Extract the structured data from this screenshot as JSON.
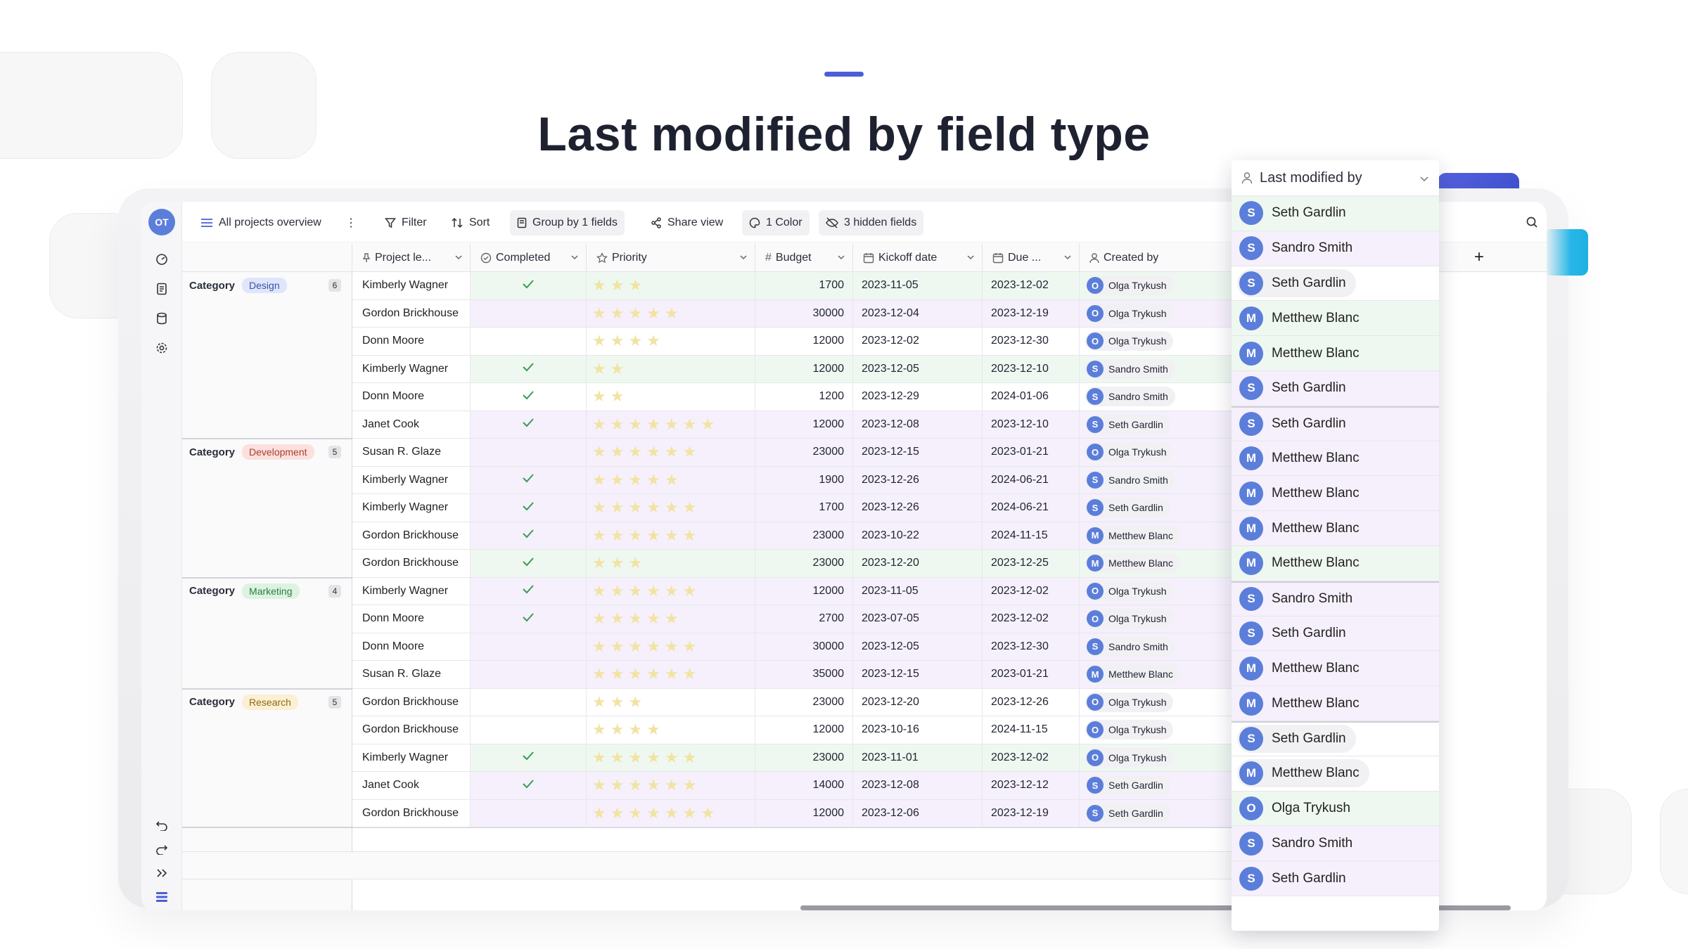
{
  "hero": {
    "title": "Last modified by field type"
  },
  "colors": {
    "accent": "#4b5fd6",
    "avatar": "#5c7edb",
    "row_green": "#eef8f0",
    "row_purple": "#f5f0fb"
  },
  "user": {
    "initials": "OT"
  },
  "toolbar": {
    "view_name": "All projects overview",
    "filter": "Filter",
    "sort": "Sort",
    "group": "Group by 1 fields",
    "share": "Share view",
    "color": "1 Color",
    "hidden": "3 hidden fields"
  },
  "columns": [
    "Project le...",
    "Completed",
    "Priority",
    "Budget",
    "Kickoff date",
    "Due ...",
    "Created by"
  ],
  "group_word": "Category",
  "groups": [
    {
      "name": "Design",
      "count": "6",
      "pill_bg": "#dfe6fb",
      "pill_fg": "#3b4fa8"
    },
    {
      "name": "Development",
      "count": "5",
      "pill_bg": "#fbe0de",
      "pill_fg": "#a8402f"
    },
    {
      "name": "Marketing",
      "count": "4",
      "pill_bg": "#dcf3e1",
      "pill_fg": "#2e7b45"
    },
    {
      "name": "Research",
      "count": "5",
      "pill_bg": "#fbf0d3",
      "pill_fg": "#8c6a16"
    }
  ],
  "rows": [
    {
      "lead": "Kimberly Wagner",
      "done": true,
      "stars": 3,
      "budget": "1700",
      "kickoff": "2023-11-05",
      "due": "2023-12-02",
      "creator": "Olga Trykush",
      "init": "O",
      "tint": "g"
    },
    {
      "lead": "Gordon Brickhouse",
      "done": false,
      "stars": 5,
      "budget": "30000",
      "kickoff": "2023-12-04",
      "due": "2023-12-19",
      "creator": "Olga Trykush",
      "init": "O",
      "tint": "p"
    },
    {
      "lead": "Donn Moore",
      "done": false,
      "stars": 4,
      "budget": "12000",
      "kickoff": "2023-12-02",
      "due": "2023-12-30",
      "creator": "Olga Trykush",
      "init": "O",
      "tint": "w"
    },
    {
      "lead": "Kimberly Wagner",
      "done": true,
      "stars": 2,
      "budget": "12000",
      "kickoff": "2023-12-05",
      "due": "2023-12-10",
      "creator": "Sandro Smith",
      "init": "S",
      "tint": "g"
    },
    {
      "lead": "Donn Moore",
      "done": true,
      "stars": 2,
      "budget": "1200",
      "kickoff": "2023-12-29",
      "due": "2024-01-06",
      "creator": "Sandro Smith",
      "init": "S",
      "tint": "w"
    },
    {
      "lead": "Janet Cook",
      "done": true,
      "stars": 7,
      "budget": "12000",
      "kickoff": "2023-12-08",
      "due": "2023-12-10",
      "creator": "Seth Gardlin",
      "init": "S",
      "tint": "p"
    },
    {
      "lead": "Susan R. Glaze",
      "done": false,
      "stars": 6,
      "budget": "23000",
      "kickoff": "2023-12-15",
      "due": "2023-01-21",
      "creator": "Olga Trykush",
      "init": "O",
      "tint": "p"
    },
    {
      "lead": "Kimberly Wagner",
      "done": true,
      "stars": 5,
      "budget": "1900",
      "kickoff": "2023-12-26",
      "due": "2024-06-21",
      "creator": "Sandro Smith",
      "init": "S",
      "tint": "p"
    },
    {
      "lead": "Kimberly Wagner",
      "done": true,
      "stars": 6,
      "budget": "1700",
      "kickoff": "2023-12-26",
      "due": "2024-06-21",
      "creator": "Seth Gardlin",
      "init": "S",
      "tint": "p"
    },
    {
      "lead": "Gordon Brickhouse",
      "done": true,
      "stars": 6,
      "budget": "23000",
      "kickoff": "2023-10-22",
      "due": "2024-11-15",
      "creator": "Metthew Blanc",
      "init": "M",
      "tint": "p"
    },
    {
      "lead": "Gordon Brickhouse",
      "done": true,
      "stars": 3,
      "budget": "23000",
      "kickoff": "2023-12-20",
      "due": "2023-12-25",
      "creator": "Metthew Blanc",
      "init": "M",
      "tint": "g"
    },
    {
      "lead": "Kimberly Wagner",
      "done": true,
      "stars": 6,
      "budget": "12000",
      "kickoff": "2023-11-05",
      "due": "2023-12-02",
      "creator": "Olga Trykush",
      "init": "O",
      "tint": "p"
    },
    {
      "lead": "Donn Moore",
      "done": true,
      "stars": 5,
      "budget": "2700",
      "kickoff": "2023-07-05",
      "due": "2023-12-02",
      "creator": "Olga Trykush",
      "init": "O",
      "tint": "p"
    },
    {
      "lead": "Donn Moore",
      "done": false,
      "stars": 6,
      "budget": "30000",
      "kickoff": "2023-12-05",
      "due": "2023-12-30",
      "creator": "Sandro Smith",
      "init": "S",
      "tint": "p"
    },
    {
      "lead": "Susan R. Glaze",
      "done": false,
      "stars": 6,
      "budget": "35000",
      "kickoff": "2023-12-15",
      "due": "2023-01-21",
      "creator": "Metthew Blanc",
      "init": "M",
      "tint": "p"
    },
    {
      "lead": "Gordon Brickhouse",
      "done": false,
      "stars": 3,
      "budget": "23000",
      "kickoff": "2023-12-20",
      "due": "2023-12-26",
      "creator": "Olga Trykush",
      "init": "O",
      "tint": "w"
    },
    {
      "lead": "Gordon Brickhouse",
      "done": false,
      "stars": 4,
      "budget": "12000",
      "kickoff": "2023-10-16",
      "due": "2024-11-15",
      "creator": "Olga Trykush",
      "init": "O",
      "tint": "w"
    },
    {
      "lead": "Kimberly Wagner",
      "done": true,
      "stars": 6,
      "budget": "23000",
      "kickoff": "2023-11-01",
      "due": "2023-12-02",
      "creator": "Olga Trykush",
      "init": "O",
      "tint": "g"
    },
    {
      "lead": "Janet Cook",
      "done": true,
      "stars": 6,
      "budget": "14000",
      "kickoff": "2023-12-08",
      "due": "2023-12-12",
      "creator": "Seth Gardlin",
      "init": "S",
      "tint": "p"
    },
    {
      "lead": "Gordon Brickhouse",
      "done": false,
      "stars": 7,
      "budget": "12000",
      "kickoff": "2023-12-06",
      "due": "2023-12-19",
      "creator": "Seth Gardlin",
      "init": "S",
      "tint": "p"
    }
  ],
  "dropdown": {
    "title": "Last modified by",
    "items": [
      {
        "name": "Seth Gardlin",
        "init": "S",
        "tint": "g"
      },
      {
        "name": "Sandro Smith",
        "init": "S",
        "tint": "p"
      },
      {
        "name": "Seth Gardlin",
        "init": "S",
        "tint": "w"
      },
      {
        "name": "Metthew Blanc",
        "init": "M",
        "tint": "g"
      },
      {
        "name": "Metthew Blanc",
        "init": "M",
        "tint": "g"
      },
      {
        "name": "Seth Gardlin",
        "init": "S",
        "tint": "p"
      },
      {
        "name": "Seth Gardlin",
        "init": "S",
        "tint": "p"
      },
      {
        "name": "Metthew Blanc",
        "init": "M",
        "tint": "p"
      },
      {
        "name": "Metthew Blanc",
        "init": "M",
        "tint": "p"
      },
      {
        "name": "Metthew Blanc",
        "init": "M",
        "tint": "p"
      },
      {
        "name": "Metthew Blanc",
        "init": "M",
        "tint": "g"
      },
      {
        "name": "Sandro Smith",
        "init": "S",
        "tint": "p"
      },
      {
        "name": "Seth Gardlin",
        "init": "S",
        "tint": "p"
      },
      {
        "name": "Metthew Blanc",
        "init": "M",
        "tint": "p"
      },
      {
        "name": "Metthew Blanc",
        "init": "M",
        "tint": "p"
      },
      {
        "name": "Seth Gardlin",
        "init": "S",
        "tint": "w"
      },
      {
        "name": "Metthew Blanc",
        "init": "M",
        "tint": "w"
      },
      {
        "name": "Olga Trykush",
        "init": "O",
        "tint": "g"
      },
      {
        "name": "Sandro Smith",
        "init": "S",
        "tint": "p"
      },
      {
        "name": "Seth Gardlin",
        "init": "S",
        "tint": "p"
      }
    ]
  }
}
